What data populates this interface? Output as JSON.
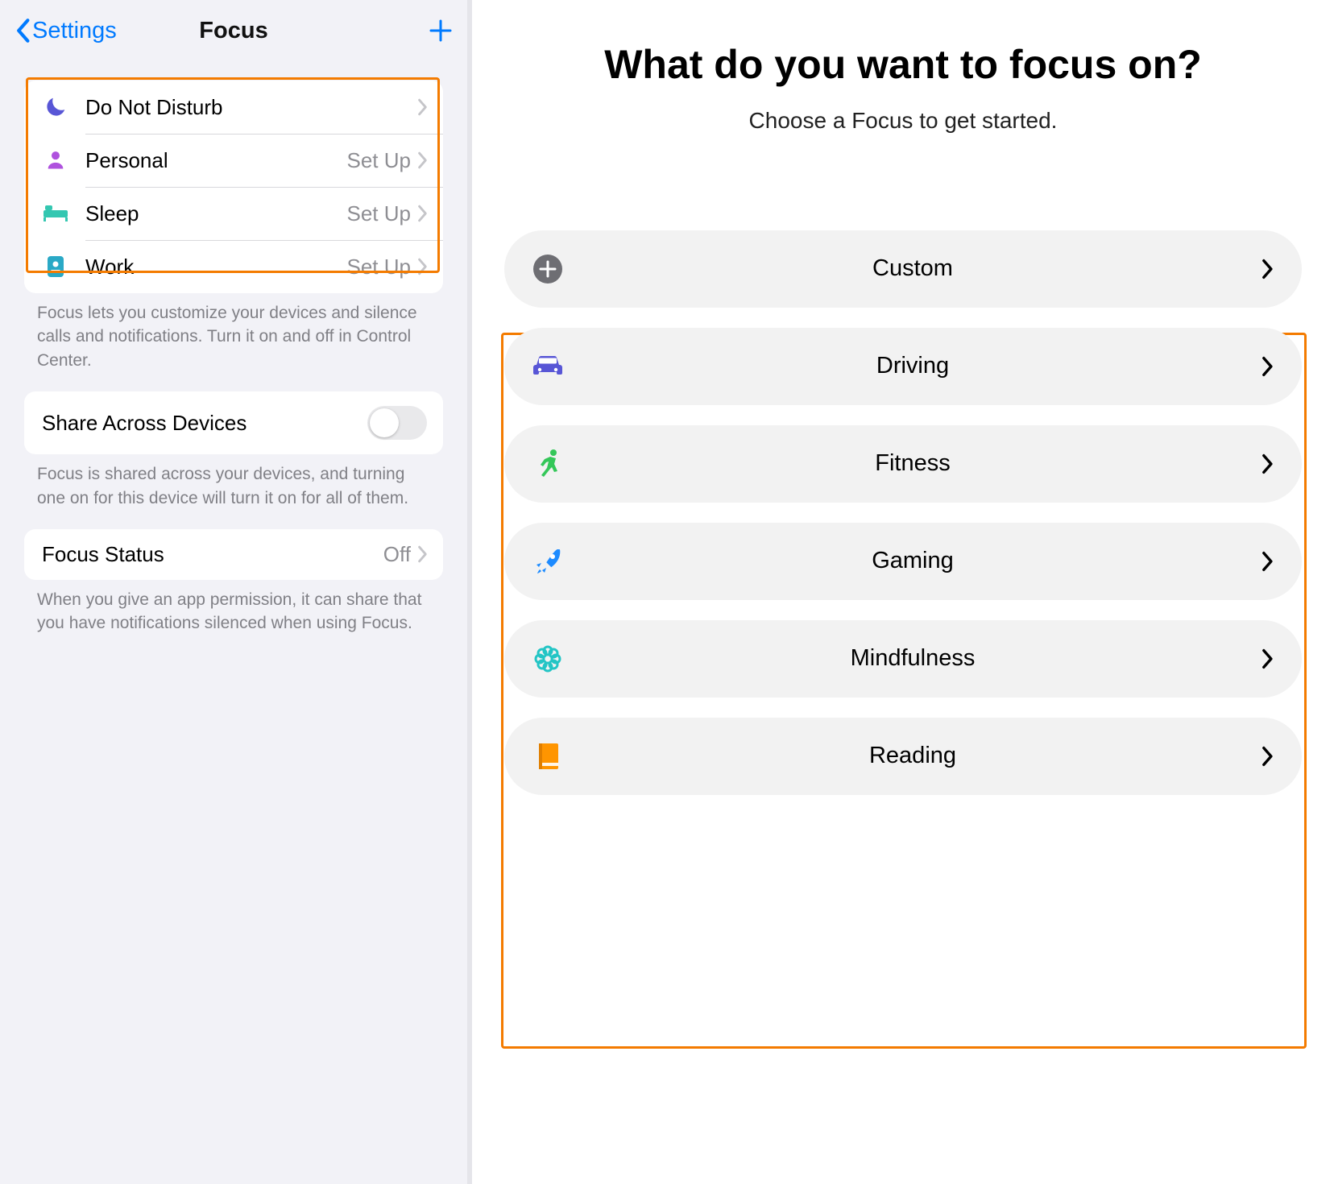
{
  "left": {
    "back_label": "Settings",
    "title": "Focus",
    "rows": [
      {
        "label": "Do Not Disturb",
        "detail": ""
      },
      {
        "label": "Personal",
        "detail": "Set Up"
      },
      {
        "label": "Sleep",
        "detail": "Set Up"
      },
      {
        "label": "Work",
        "detail": "Set Up"
      }
    ],
    "footer1": "Focus lets you customize your devices and silence calls and notifications. Turn it on and off in Control Center.",
    "share_label": "Share Across Devices",
    "footer2": "Focus is shared across your devices, and turning one on for this device will turn it on for all of them.",
    "status_label": "Focus Status",
    "status_value": "Off",
    "footer3": "When you give an app permission, it can share that you have notifications silenced when using Focus."
  },
  "right": {
    "title": "What do you want to focus on?",
    "subtitle": "Choose a Focus to get started.",
    "pills": [
      {
        "label": "Custom"
      },
      {
        "label": "Driving"
      },
      {
        "label": "Fitness"
      },
      {
        "label": "Gaming"
      },
      {
        "label": "Mindfulness"
      },
      {
        "label": "Reading"
      }
    ]
  },
  "colors": {
    "moon": "#5856d6",
    "person": "#af52de",
    "bed": "#34c7b1",
    "badge": "#2aa9c6",
    "plusCircle": "#6e6e73",
    "car": "#5856d6",
    "fitness": "#34c759",
    "rocket": "#1d8bff",
    "flower": "#23c5c5",
    "book": "#ff9500"
  }
}
